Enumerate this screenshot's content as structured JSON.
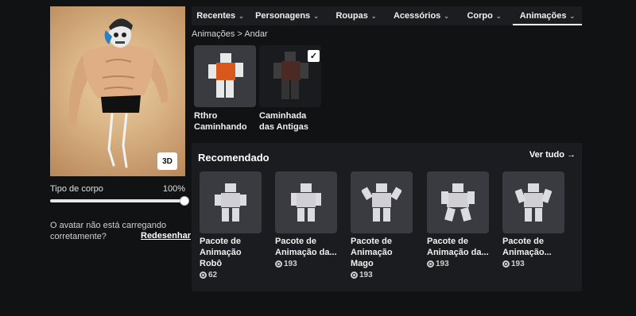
{
  "left": {
    "btn_3d": "3D",
    "body_type_label": "Tipo de corpo",
    "body_type_value": "100%",
    "body_type_fraction": 1.0,
    "help_text": "O avatar não está carregando corretamente?",
    "redraw_link": "Redesenhar"
  },
  "tabs": [
    {
      "label": "Recentes",
      "active": false
    },
    {
      "label": "Personagens",
      "active": false
    },
    {
      "label": "Roupas",
      "active": false
    },
    {
      "label": "Acessórios",
      "active": false
    },
    {
      "label": "Corpo",
      "active": false
    },
    {
      "label": "Animações",
      "active": true
    }
  ],
  "breadcrumb": "Animações > Andar",
  "owned": [
    {
      "label": "Rthro Caminhando",
      "selected": false
    },
    {
      "label": "Caminhada das Antigas",
      "selected": true
    }
  ],
  "recommended": {
    "title": "Recomendado",
    "see_all": "Ver tudo",
    "items": [
      {
        "name": "Pacote de Animação Robô",
        "price": "62"
      },
      {
        "name": "Pacote de Animação da...",
        "price": "193"
      },
      {
        "name": "Pacote de Animação Mago",
        "price": "193"
      },
      {
        "name": "Pacote de Animação da...",
        "price": "193"
      },
      {
        "name": "Pacote de Animação...",
        "price": "193"
      }
    ]
  },
  "colors": {
    "background": "#111214",
    "panel": "#1b1c1f",
    "tabbar": "#1c1d20",
    "thumb": "#3a3b40",
    "selected_thumb": "#2e3034"
  }
}
